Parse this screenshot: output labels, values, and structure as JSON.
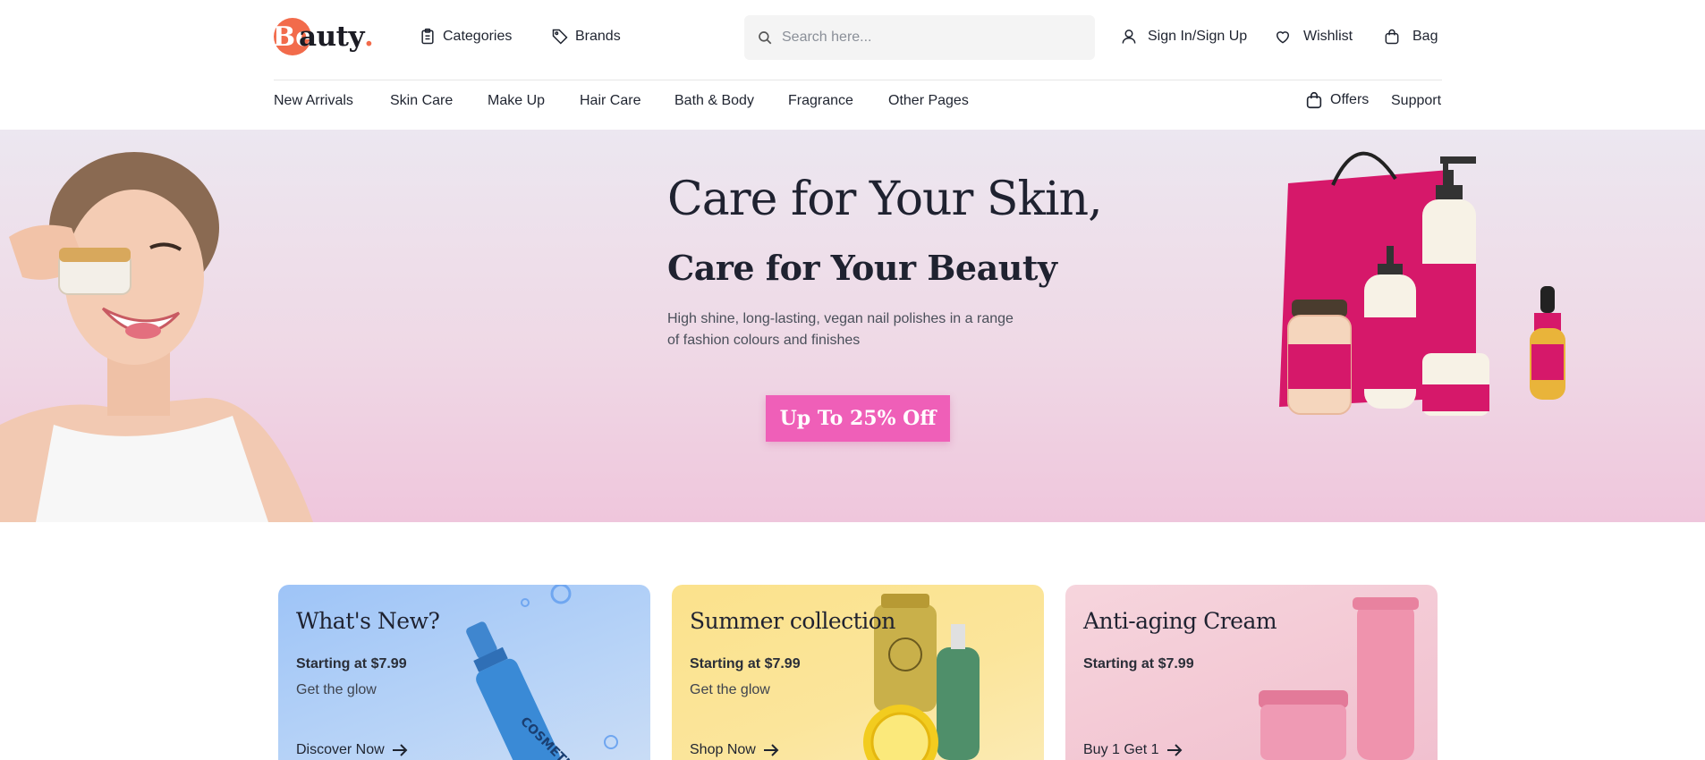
{
  "logo": {
    "badge_letter": "Be",
    "rest": "auty",
    "dot": "."
  },
  "header": {
    "categories_label": "Categories",
    "brands_label": "Brands",
    "search_placeholder": "Search here...",
    "sign_in_label": "Sign In/Sign Up",
    "wishlist_label": "Wishlist",
    "bag_label": "Bag"
  },
  "nav": {
    "items": [
      "New Arrivals",
      "Skin Care",
      "Make Up",
      "Hair Care",
      "Bath & Body",
      "Fragrance",
      "Other Pages"
    ],
    "offers_label": "Offers",
    "support_label": "Support"
  },
  "hero": {
    "title_line1": "Care for Your Skin,",
    "title_line2": "Care for Your Beauty",
    "description": "High shine, long-lasting, vegan nail polishes in a range of fashion colours and finishes",
    "cta_label": "Up To 25% Off"
  },
  "cards": [
    {
      "title": "What's New?",
      "price": "Starting at $7.99",
      "subtitle": "Get the glow",
      "link": "Discover Now"
    },
    {
      "title": "Summer collection",
      "price": "Starting at $7.99",
      "subtitle": "Get the glow",
      "link": "Shop Now"
    },
    {
      "title": "Anti-aging Cream",
      "price": "Starting at $7.99",
      "subtitle": "",
      "link": "Buy 1 Get 1"
    }
  ],
  "colors": {
    "accent": "#f26b4b",
    "cta": "#ef5fb8",
    "hero_bg": "#efd9e6"
  }
}
